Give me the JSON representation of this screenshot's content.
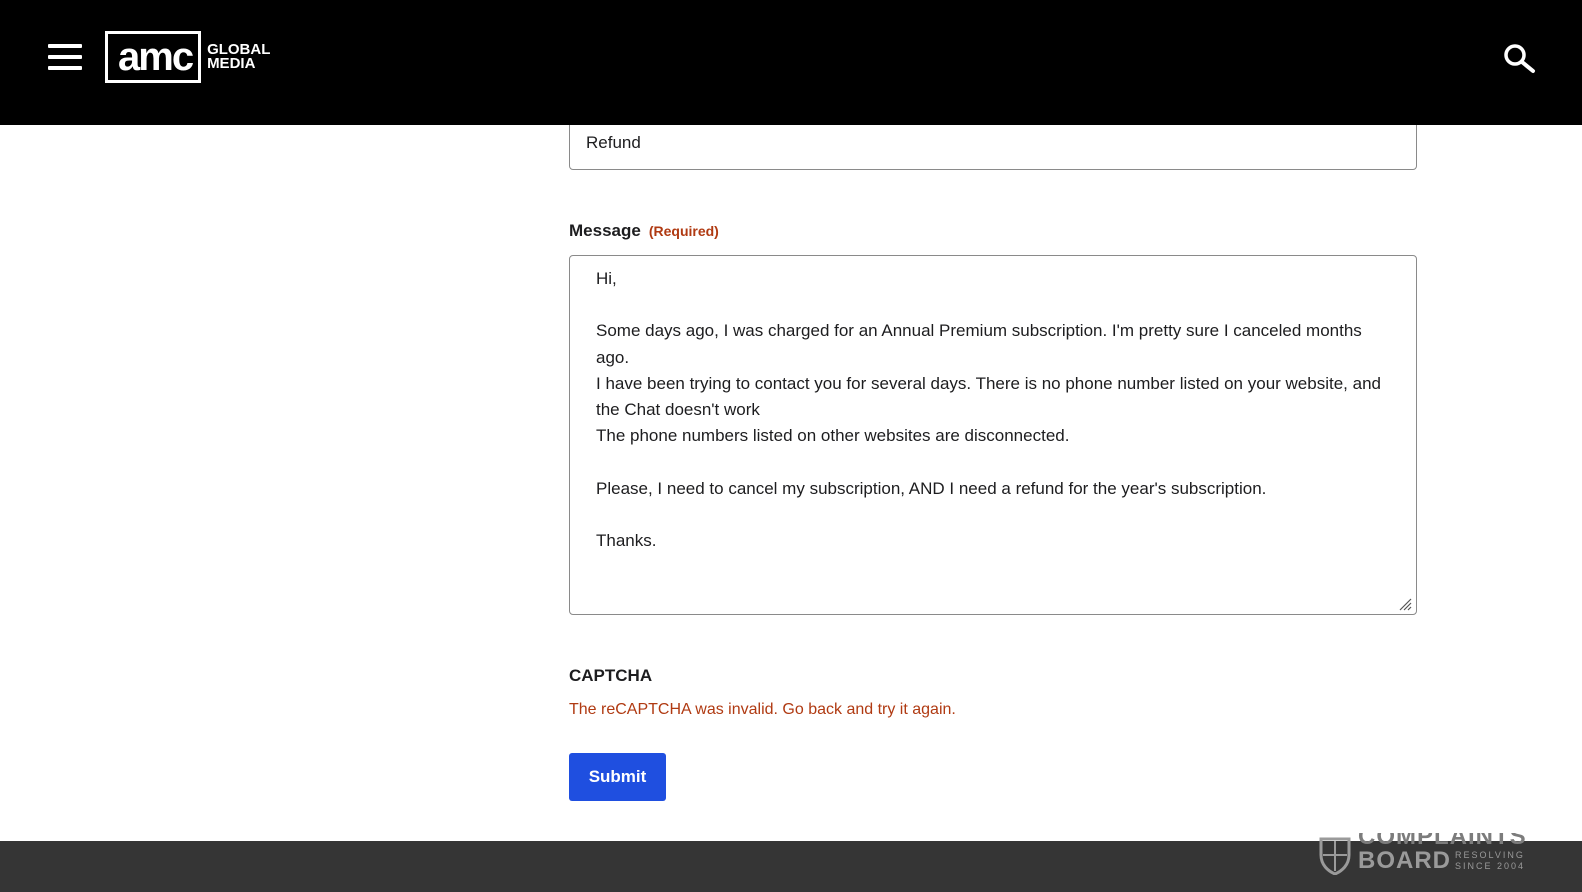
{
  "header": {
    "menu_icon": "hamburger-menu-icon",
    "logo": {
      "main": "amc",
      "line1": "GLOBAL",
      "line2": "MEDIA"
    },
    "search_icon": "search-icon"
  },
  "form": {
    "subject_value": "Refund",
    "message_label": "Message",
    "message_required": "(Required)",
    "message_value": "Hi,\n\nSome days ago, I was charged for an Annual Premium subscription. I'm pretty sure I canceled months ago.\nI have been trying to contact you for several days. There is no phone number listed on your website, and the Chat doesn't work\nThe phone numbers listed on other websites are disconnected.\n\nPlease, I need to cancel my subscription, AND I need a refund for the year's subscription.\n\nThanks.",
    "captcha_label": "CAPTCHA",
    "captcha_error": "The reCAPTCHA was invalid. Go back and try it again.",
    "submit_label": "Submit"
  },
  "footer": {
    "badge_icon": "shield-icon",
    "badge_top": "COMPLAINTS",
    "badge_bottom": "BOARD",
    "badge_small1": "RESOLVING",
    "badge_small2": "SINCE 2004"
  },
  "colors": {
    "header_bg": "#000000",
    "submit_bg": "#1f4fe0",
    "error_text": "#b03a12",
    "footer_bg": "#353535"
  }
}
